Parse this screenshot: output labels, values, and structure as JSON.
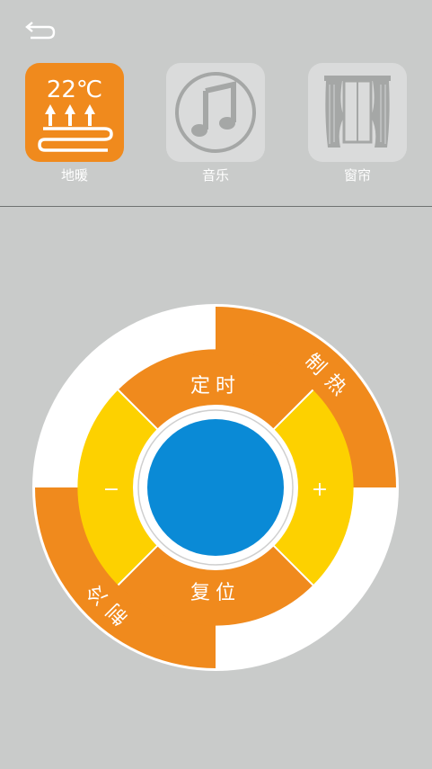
{
  "header": {
    "back_icon": "back-arrow-icon"
  },
  "devices": [
    {
      "id": "floor-heating",
      "label": "地暖",
      "temp": "22℃",
      "icon": "floor-heating-icon",
      "active": true
    },
    {
      "id": "music",
      "label": "音乐",
      "icon": "music-note-icon",
      "active": false
    },
    {
      "id": "curtain",
      "label": "窗帘",
      "icon": "curtain-icon",
      "active": false
    }
  ],
  "controls": {
    "heat": "制热",
    "cool": "制冷",
    "timer": "定时",
    "reset": "复位",
    "minus": "−",
    "plus": "+"
  },
  "colors": {
    "orange": "#f08a1d",
    "yellow": "#fdd100",
    "blue": "#0a8ad6",
    "background": "#c9cbca"
  }
}
